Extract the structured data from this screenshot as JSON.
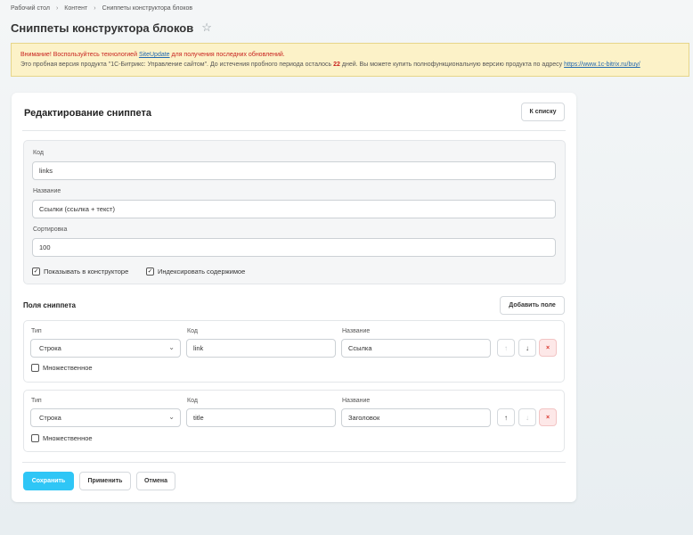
{
  "breadcrumb": {
    "items": [
      "Рабочий стол",
      "Контент",
      "Сниппеты конструктора блоков"
    ],
    "separator": "›"
  },
  "page_title": "Сниппеты конструктора блоков",
  "star_icon": "☆",
  "notice": {
    "warning": "Внимание! Воспользуйтесь технологией",
    "link_siteupdate": "SiteUpdate",
    "warning_tail": "для получения последних обновлений.",
    "trial_text": "Это пробная версия продукта \"1С-Битрикс: Управление сайтом\". До истечения пробного периода осталось",
    "days": "22",
    "trial_tail": "дней. Вы можете купить полнофункциональную версию продукта по адресу",
    "buy_link": "https://www.1c-bitrix.ru/buy/"
  },
  "card": {
    "title": "Редактирование сниппета",
    "back_button": "К списку"
  },
  "form": {
    "code_label": "Код",
    "code_value": "links",
    "name_label": "Название",
    "name_value": "Ссылки (ссылка + текст)",
    "sort_label": "Сортировка",
    "sort_value": "100",
    "show_in_constructor": "Показывать в конструкторе",
    "index_content": "Индексировать содержимое",
    "check_mark": "✓"
  },
  "fields_section": {
    "title": "Поля сниппета",
    "add_button": "Добавить поле",
    "type_label": "Тип",
    "code_label": "Код",
    "name_label": "Название",
    "multiple_label": "Множественное",
    "up_icon": "↑",
    "down_icon": "↓",
    "delete_icon": "×",
    "chevron_icon": "⌄",
    "rows": [
      {
        "type": "Строка",
        "code": "link",
        "name": "Ссылка"
      },
      {
        "type": "Строка",
        "code": "title",
        "name": "Заголовок"
      }
    ]
  },
  "actions": {
    "save": "Сохранить",
    "apply": "Применить",
    "cancel": "Отмена"
  },
  "colors": {
    "accent": "#2fc6f6",
    "notice_bg": "#fcf2c8",
    "warning": "#c8231f",
    "delete": "#d9342b"
  }
}
